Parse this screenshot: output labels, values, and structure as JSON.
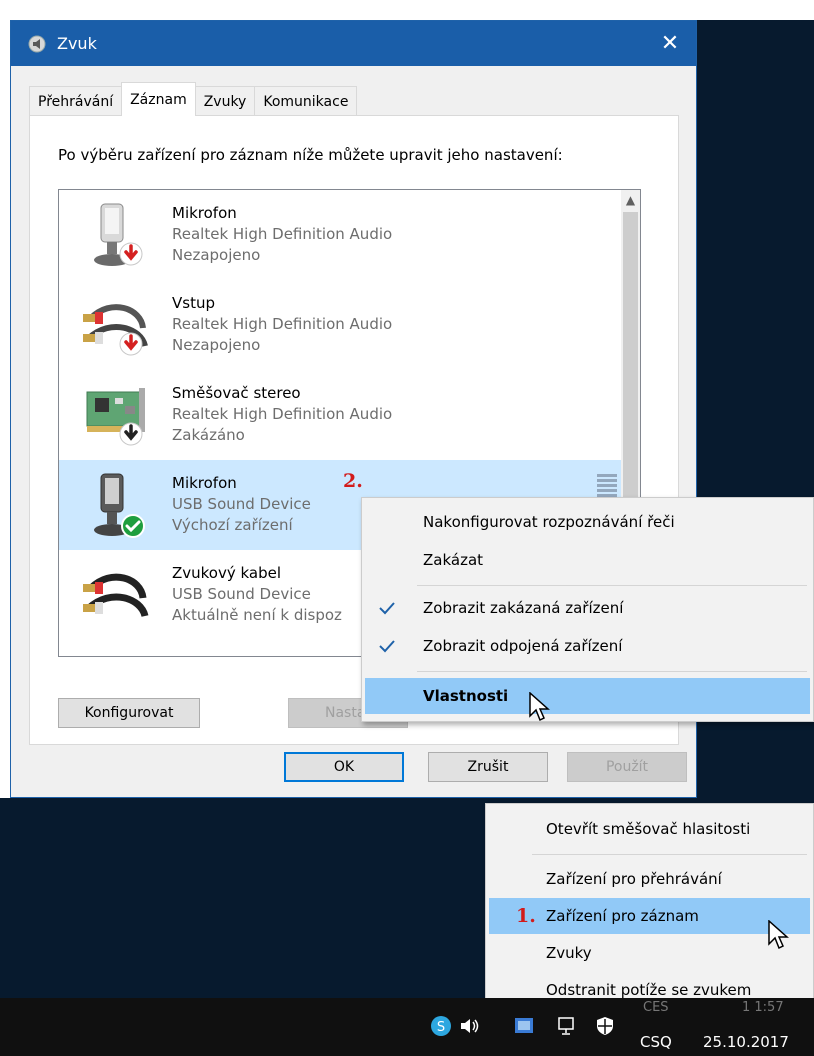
{
  "window": {
    "title": "Zvuk",
    "close_glyph": "✕"
  },
  "tabs": [
    {
      "label": "Přehrávání",
      "active": false
    },
    {
      "label": "Záznam",
      "active": true
    },
    {
      "label": "Zvuky",
      "active": false
    },
    {
      "label": "Komunikace",
      "active": false
    }
  ],
  "instruction": "Po výběru zařízení pro záznam níže můžete upravit jeho nastavení:",
  "devices": [
    {
      "name": "Mikrofon",
      "driver": "Realtek High Definition Audio",
      "status": "Nezapojeno",
      "icon": "microphone-icon",
      "badge": "disconnected-badge-icon"
    },
    {
      "name": "Vstup",
      "driver": "Realtek High Definition Audio",
      "status": "Nezapojeno",
      "icon": "rca-cable-icon",
      "badge": "disconnected-badge-icon"
    },
    {
      "name": "Směšovač stereo",
      "driver": "Realtek High Definition Audio",
      "status": "Zakázáno",
      "icon": "sound-card-icon",
      "badge": "disabled-badge-icon"
    },
    {
      "name": "Mikrofon",
      "driver": "USB Sound Device",
      "status": "Výchozí zařízení",
      "icon": "microphone-icon",
      "badge": "default-check-badge-icon",
      "selected": true
    },
    {
      "name": "Zvukový kabel",
      "driver": "USB Sound Device",
      "status": "Aktuálně není k dispoz",
      "icon": "rca-cable-icon"
    }
  ],
  "annotation_2": "2.",
  "annotation_1": "1.",
  "buttons": {
    "configure": "Konfigurovat",
    "properties_partial": "Nasta",
    "ok": "OK",
    "cancel": "Zrušit",
    "apply": "Použít"
  },
  "device_menu": {
    "items": [
      {
        "label": "Nakonfigurovat rozpoznávání řeči"
      },
      {
        "label": "Zakázat"
      },
      {
        "label": "Zobrazit zakázaná zařízení",
        "checked": true
      },
      {
        "label": "Zobrazit odpojená zařízení",
        "checked": true
      },
      {
        "label": "Vlastnosti",
        "bold": true,
        "highlighted": true
      }
    ]
  },
  "tray_menu": {
    "items": [
      {
        "label": "Otevřít směšovač hlasitosti"
      },
      {
        "label": "Zařízení pro přehrávání"
      },
      {
        "label": "Zařízení pro záznam",
        "highlighted": true
      },
      {
        "label": "Zvuky"
      },
      {
        "label": "Odstranit potíže se zvukem"
      }
    ]
  },
  "taskbar": {
    "language": "CSQ",
    "date": "25.10.2017",
    "ghost_lang": "CES",
    "ghost_time": "1 1:57"
  },
  "colors": {
    "titlebar": "#1a5ea9",
    "selection": "#cce8ff",
    "menu_highlight": "#91c9f7",
    "annotation_red": "#d21b1b",
    "desktop": "#071a2e"
  }
}
